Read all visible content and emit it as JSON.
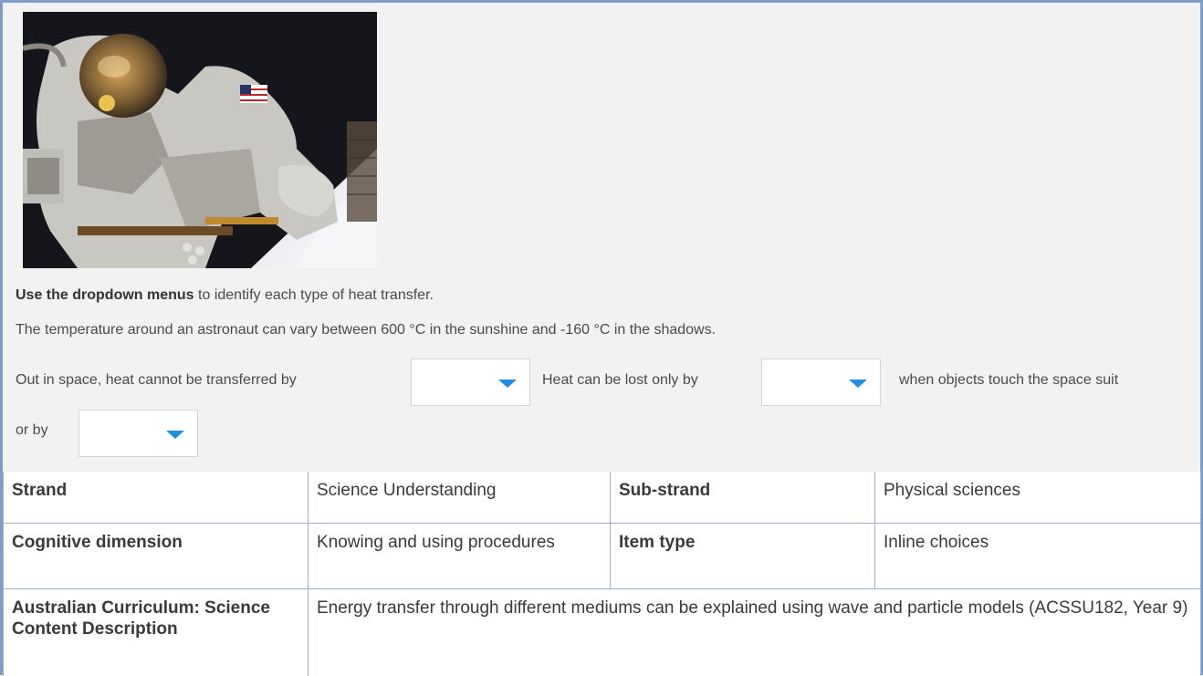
{
  "question": {
    "image": {
      "alt": "astronaut-spacewalk-photo"
    },
    "instruction_bold": "Use the dropdown menus",
    "instruction_rest": " to identify each type of heat transfer.",
    "context": "The temperature around an astronaut can vary between 600 °C in the sunshine and -160 °C in the shadows.",
    "sentence_part1": "Out in space, heat cannot be transferred by",
    "sentence_part2": "Heat can be lost only by",
    "sentence_part3": "when objects touch the space suit",
    "sentence_part4": "or by",
    "dropdowns": [
      {
        "selected": ""
      },
      {
        "selected": ""
      },
      {
        "selected": ""
      }
    ],
    "accent_color": "#1f8de6"
  },
  "metadata": {
    "rows": [
      [
        "Strand",
        "Science Understanding",
        "Sub-strand",
        "Physical sciences"
      ],
      [
        "Cognitive dimension",
        "Knowing and using procedures",
        "Item type",
        "Inline choices"
      ],
      [
        "Australian Curriculum: Science Content Description",
        "Energy transfer through different mediums can be explained using wave and particle models (ACSSU182, Year 9)"
      ]
    ]
  }
}
